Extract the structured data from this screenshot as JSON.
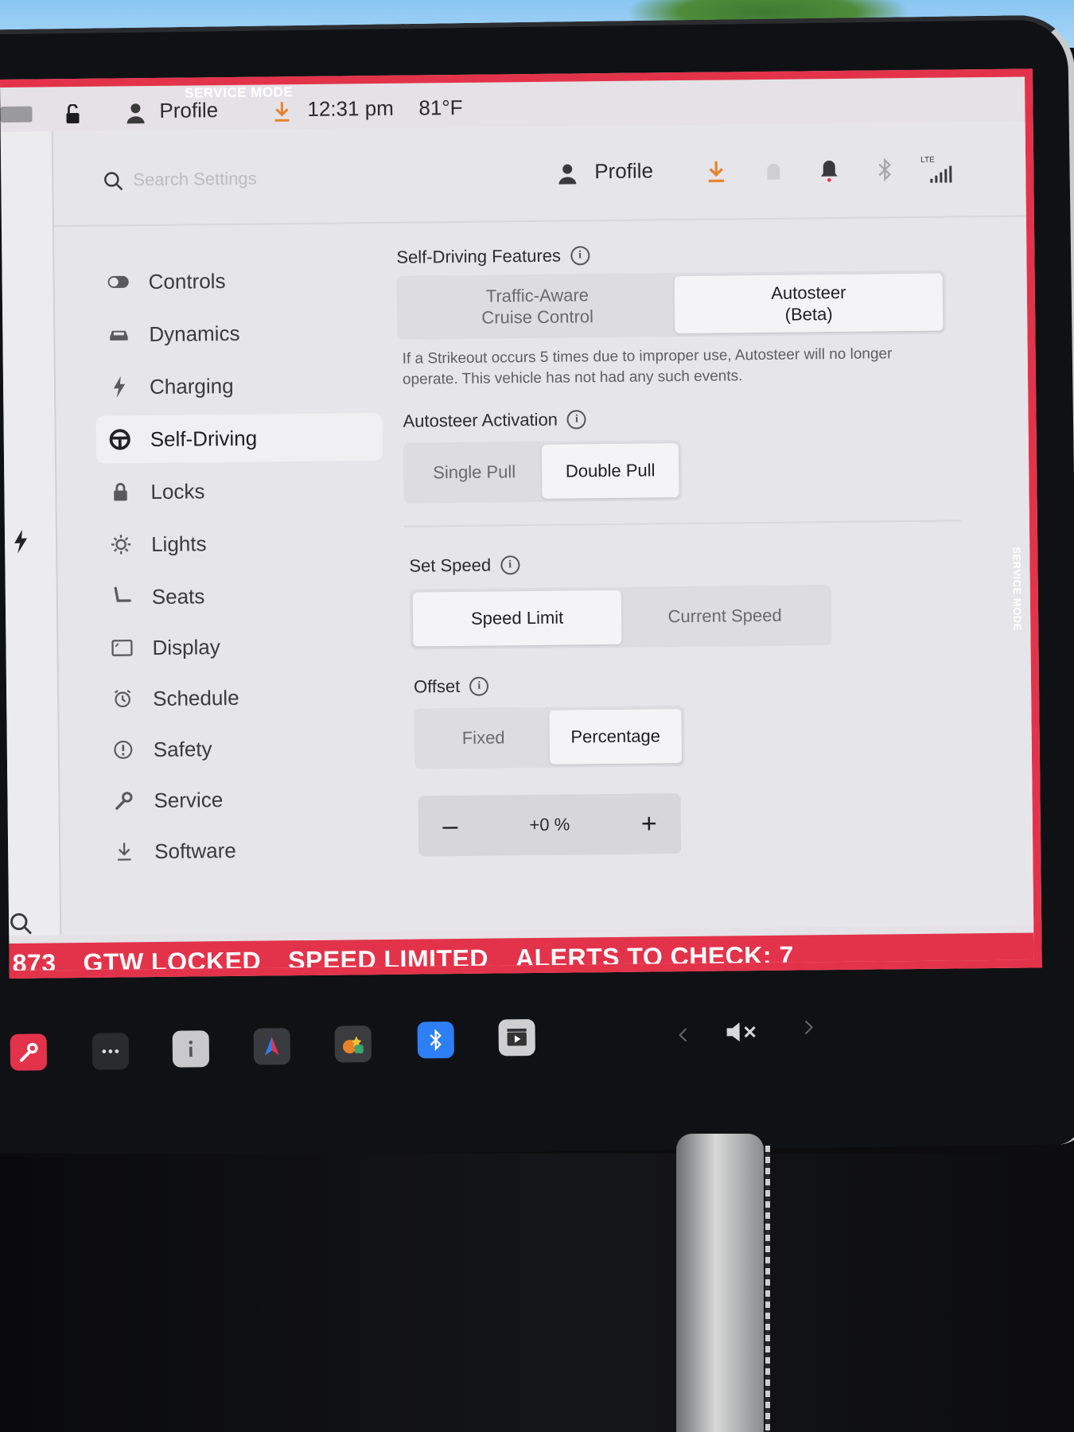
{
  "status_bar": {
    "service_mode_top": "SERVICE MODE",
    "profile": "Profile",
    "time": "12:31 pm",
    "temperature": "81°F"
  },
  "header": {
    "search_placeholder": "Search Settings",
    "profile": "Profile",
    "lte": "LTE"
  },
  "sidebar": {
    "items": [
      {
        "label": "Controls",
        "icon": "toggle-icon"
      },
      {
        "label": "Dynamics",
        "icon": "car-icon"
      },
      {
        "label": "Charging",
        "icon": "bolt-icon"
      },
      {
        "label": "Self-Driving",
        "icon": "steering-wheel-icon",
        "active": true
      },
      {
        "label": "Locks",
        "icon": "lock-icon"
      },
      {
        "label": "Lights",
        "icon": "sun-icon"
      },
      {
        "label": "Seats",
        "icon": "seat-icon"
      },
      {
        "label": "Display",
        "icon": "display-icon"
      },
      {
        "label": "Schedule",
        "icon": "alarm-clock-icon"
      },
      {
        "label": "Safety",
        "icon": "warning-circle-icon"
      },
      {
        "label": "Service",
        "icon": "wrench-icon"
      },
      {
        "label": "Software",
        "icon": "download-icon"
      }
    ]
  },
  "self_driving": {
    "features_title": "Self-Driving Features",
    "features_options": [
      "Traffic-Aware\nCruise Control",
      "Autosteer\n(Beta)"
    ],
    "features_selected": 1,
    "strikeout_help": "If a Strikeout occurs 5 times due to improper use, Autosteer will no longer operate. This vehicle has not had any such events.",
    "activation_title": "Autosteer Activation",
    "activation_options": [
      "Single Pull",
      "Double Pull"
    ],
    "activation_selected": 1,
    "set_speed_title": "Set Speed",
    "set_speed_options": [
      "Speed Limit",
      "Current Speed"
    ],
    "set_speed_selected": 0,
    "offset_title": "Offset",
    "offset_options": [
      "Fixed",
      "Percentage"
    ],
    "offset_selected": 1,
    "offset_value": "+0 %",
    "minus": "–",
    "plus": "+"
  },
  "service_mode_side": "SERVICE MODE",
  "alerts": {
    "code": "873",
    "gtw": "GTW LOCKED",
    "speed": "SPEED LIMITED",
    "alerts_to_check": "ALERTS TO CHECK: 7"
  },
  "colors": {
    "service_red": "#e3334a",
    "download_orange": "#e8822a",
    "bluetooth_blue": "#2d7ff5"
  }
}
